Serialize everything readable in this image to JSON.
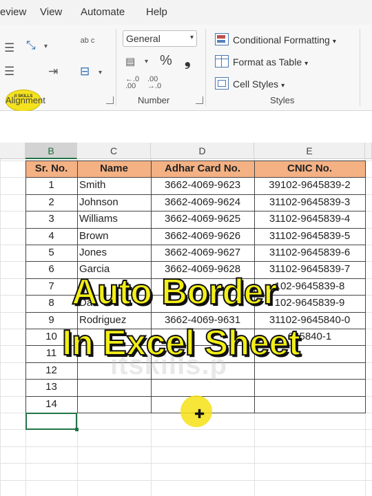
{
  "menu": [
    "eview",
    "View",
    "Automate",
    "Help"
  ],
  "ribbon": {
    "alignment_label": "Alignment",
    "number_label": "Number",
    "styles_label": "Styles",
    "number_format": "General",
    "percent_symbol": "%",
    "comma_symbol": "❟",
    "wrap_glyph": "ab c",
    "inc_decimal": "←.0 .00",
    "dec_decimal": ".00 →.0",
    "conditional_formatting": "Conditional Formatting",
    "format_as_table": "Format as Table",
    "cell_styles": "Cell Styles",
    "logo_text": "it SKILLS"
  },
  "columns": [
    {
      "letter": "B",
      "selected": true
    },
    {
      "letter": "C",
      "selected": false
    },
    {
      "letter": "D",
      "selected": false
    },
    {
      "letter": "E",
      "selected": false
    }
  ],
  "table": {
    "headers": [
      "Sr. No.",
      "Name",
      "Adhar Card No.",
      "CNIC No."
    ],
    "rows": [
      [
        "1",
        "Smith",
        "3662-4069-9623",
        "39102-9645839-2"
      ],
      [
        "2",
        "Johnson",
        "3662-4069-9624",
        "31102-9645839-3"
      ],
      [
        "3",
        "Williams",
        "3662-4069-9625",
        "31102-9645839-4"
      ],
      [
        "4",
        "Brown",
        "3662-4069-9626",
        "31102-9645839-5"
      ],
      [
        "5",
        "Jones",
        "3662-4069-9627",
        "31102-9645839-6"
      ],
      [
        "6",
        "Garcia",
        "3662-4069-9628",
        "31102-9645839-7"
      ],
      [
        "7",
        "",
        "",
        "102-9645839-8"
      ],
      [
        "8",
        "Da",
        "",
        "102-9645839-9"
      ],
      [
        "9",
        "Rodriguez",
        "3662-4069-9631",
        "31102-9645840-0"
      ],
      [
        "10",
        "",
        "",
        "645840-1"
      ],
      [
        "11",
        "",
        "",
        ""
      ],
      [
        "12",
        "",
        "",
        ""
      ],
      [
        "13",
        "",
        "",
        ""
      ],
      [
        "14",
        "",
        "",
        ""
      ]
    ]
  },
  "overlay": {
    "line1": "Auto Border",
    "line2": "In Excel Sheet",
    "watermark": "itskills.p"
  },
  "colors": {
    "header_fill": "#f4b184",
    "overlay_text": "#f3ef16",
    "selection_green": "#217346"
  }
}
